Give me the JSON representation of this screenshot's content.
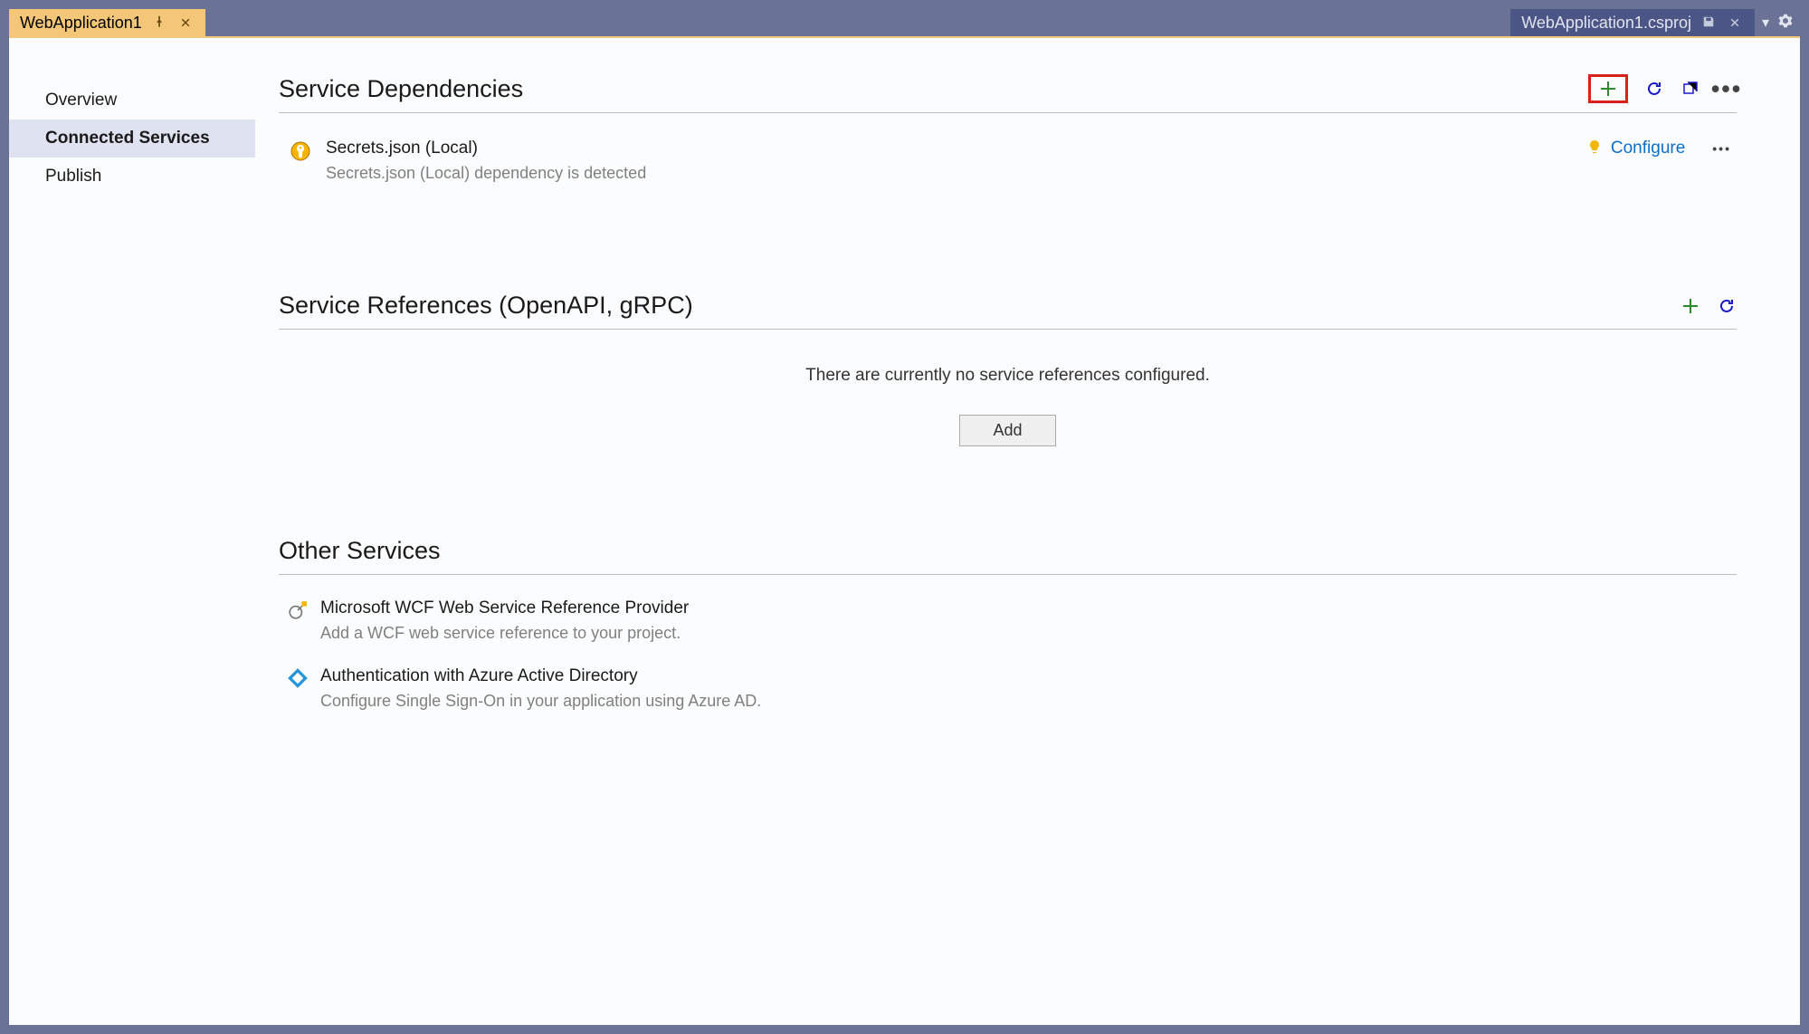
{
  "tabs": {
    "left_title": "WebApplication1",
    "right_title": "WebApplication1.csproj"
  },
  "sidebar": {
    "items": [
      {
        "label": "Overview"
      },
      {
        "label": "Connected Services"
      },
      {
        "label": "Publish"
      }
    ]
  },
  "sections": {
    "dependencies": {
      "title": "Service Dependencies",
      "items": [
        {
          "name": "Secrets.json (Local)",
          "desc": "Secrets.json (Local) dependency is detected",
          "action": "Configure"
        }
      ]
    },
    "references": {
      "title": "Service References (OpenAPI, gRPC)",
      "empty_text": "There are currently no service references configured.",
      "add_label": "Add"
    },
    "other": {
      "title": "Other Services",
      "items": [
        {
          "name": "Microsoft WCF Web Service Reference Provider",
          "desc": "Add a WCF web service reference to your project."
        },
        {
          "name": "Authentication with Azure Active Directory",
          "desc": "Configure Single Sign-On in your application using Azure AD."
        }
      ]
    }
  }
}
